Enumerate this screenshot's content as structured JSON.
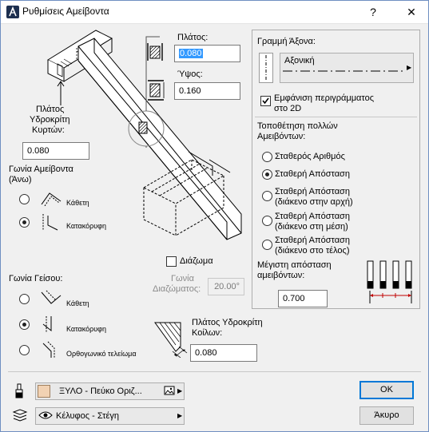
{
  "window": {
    "title": "Ρυθμίσεις Αμείβοντα",
    "help": "?",
    "close": "✕"
  },
  "profile": {
    "width_label": "Πλάτος:",
    "width_value": "0.080",
    "height_label": "Ύψος:",
    "height_value": "0.160"
  },
  "left": {
    "curtain_width_label_1": "Πλάτος",
    "curtain_width_label_2": "Υδροκρίτη",
    "curtain_width_label_3": "Κυρτών:",
    "curtain_width_value": "0.080",
    "angle_title_1": "Γωνία Αμείβοντα",
    "angle_title_2": "(Άνω)",
    "angle_options": [
      "Κάθετη",
      "Κατακόρυφη"
    ],
    "eave_title": "Γωνία Γείσου:",
    "eave_options": [
      "Κάθετη",
      "Κατακόρυφη",
      "Ορθογωνικό τελείωμα"
    ]
  },
  "center": {
    "gap_label": "Διάζωμα",
    "gap_angle_label_1": "Γωνία",
    "gap_angle_label_2": "Διαζώματος:",
    "gap_angle_value": "20.00°",
    "valley_label_1": "Πλάτος Υδροκρίτη",
    "valley_label_2": "Κοίλων:",
    "valley_value": "0.080"
  },
  "axis": {
    "title": "Γραμμή Άξονα:",
    "line_name": "Αξονική",
    "show_outline_1": "Εμφάνιση περιγράμματος",
    "show_outline_2": "στο 2D"
  },
  "placement": {
    "title_1": "Τοποθέτηση πολλών",
    "title_2": "Αμειβόντων:",
    "options": [
      {
        "l1": "Σταθερός Αριθμός",
        "l2": ""
      },
      {
        "l1": "Σταθερή Απόσταση",
        "l2": ""
      },
      {
        "l1": "Σταθερή Απόσταση",
        "l2": "(διάκενο στην αρχή)"
      },
      {
        "l1": "Σταθερή Απόσταση",
        "l2": "(διάκενο στη μέση)"
      },
      {
        "l1": "Σταθερή Απόσταση",
        "l2": "(διάκενο στο τέλος)"
      }
    ],
    "max_dist_1": "Μέγιστη απόσταση",
    "max_dist_2": "αμειβόντων:",
    "max_dist_value": "0.700"
  },
  "footer": {
    "material": "ΞΥΛΟ - Πεύκο Οριζ...",
    "layer": "Κέλυφος - Στέγη",
    "ok": "OK",
    "cancel": "Άκυρο"
  },
  "colors": {
    "selection": "#3399ff",
    "default_button": "#0078d7",
    "material_swatch": "#f2d2b3"
  }
}
